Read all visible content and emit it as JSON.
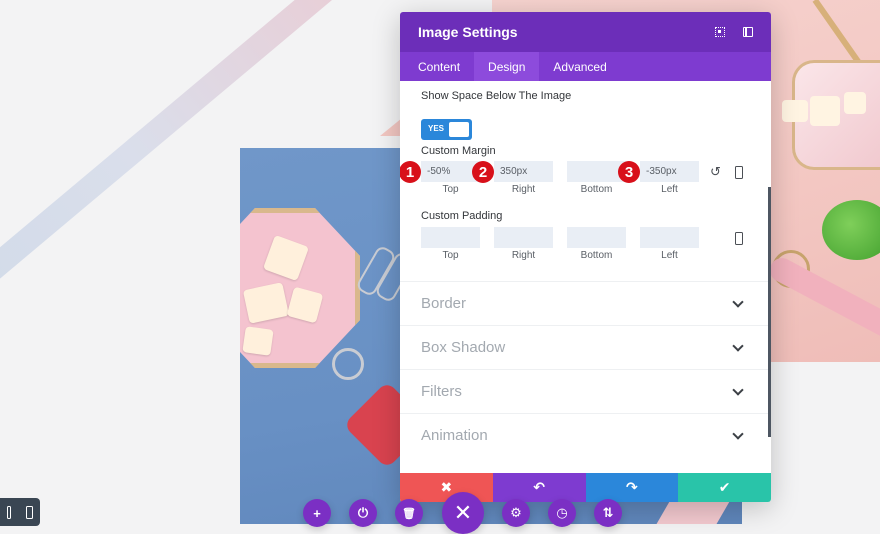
{
  "modal": {
    "title": "Image Settings",
    "header_icons": [
      "expand-icon",
      "split-view-icon"
    ],
    "tabs": [
      {
        "label": "Content",
        "active": false
      },
      {
        "label": "Design",
        "active": true
      },
      {
        "label": "Advanced",
        "active": false
      }
    ],
    "show_space": {
      "label": "Show Space Below The Image",
      "toggle_label": "YES",
      "value": true
    },
    "custom_margin": {
      "label": "Custom Margin",
      "fields": [
        {
          "caption": "Top",
          "value": "-50%",
          "badge": "1"
        },
        {
          "caption": "Right",
          "value": "350px",
          "badge": "2"
        },
        {
          "caption": "Bottom",
          "value": "",
          "badge": ""
        },
        {
          "caption": "Left",
          "value": "-350px",
          "badge": "3"
        }
      ],
      "icons": [
        "reset-icon",
        "phone-icon"
      ]
    },
    "custom_padding": {
      "label": "Custom Padding",
      "fields": [
        {
          "caption": "Top",
          "value": ""
        },
        {
          "caption": "Right",
          "value": ""
        },
        {
          "caption": "Bottom",
          "value": ""
        },
        {
          "caption": "Left",
          "value": ""
        }
      ],
      "icons": [
        "phone-icon"
      ]
    },
    "sections": [
      {
        "label": "Border"
      },
      {
        "label": "Box Shadow"
      },
      {
        "label": "Filters"
      },
      {
        "label": "Animation"
      }
    ],
    "footer": [
      {
        "icon": "close-icon",
        "glyph": "✖",
        "color": "#ef5555"
      },
      {
        "icon": "undo-icon",
        "glyph": "↶",
        "color": "#7e3bd0"
      },
      {
        "icon": "redo-icon",
        "glyph": "↷",
        "color": "#2b87da"
      },
      {
        "icon": "check-icon",
        "glyph": "✔",
        "color": "#29c4a9"
      }
    ]
  },
  "bottom_toolbar": [
    {
      "icon": "add-icon",
      "glyph": "+"
    },
    {
      "icon": "power-icon",
      "glyph": "⏻"
    },
    {
      "icon": "trash-icon",
      "glyph": "🗑"
    },
    {
      "icon": "close-icon",
      "glyph": "✕"
    },
    {
      "icon": "gear-icon",
      "glyph": "⚙"
    },
    {
      "icon": "history-icon",
      "glyph": "◷"
    },
    {
      "icon": "sort-icon",
      "glyph": "⇅"
    }
  ],
  "colors": {
    "header_purple": "#6c2eb9",
    "tabs_purple": "#7e3bd0",
    "toggle_blue": "#2b87da",
    "badge_red": "#d8101a"
  }
}
